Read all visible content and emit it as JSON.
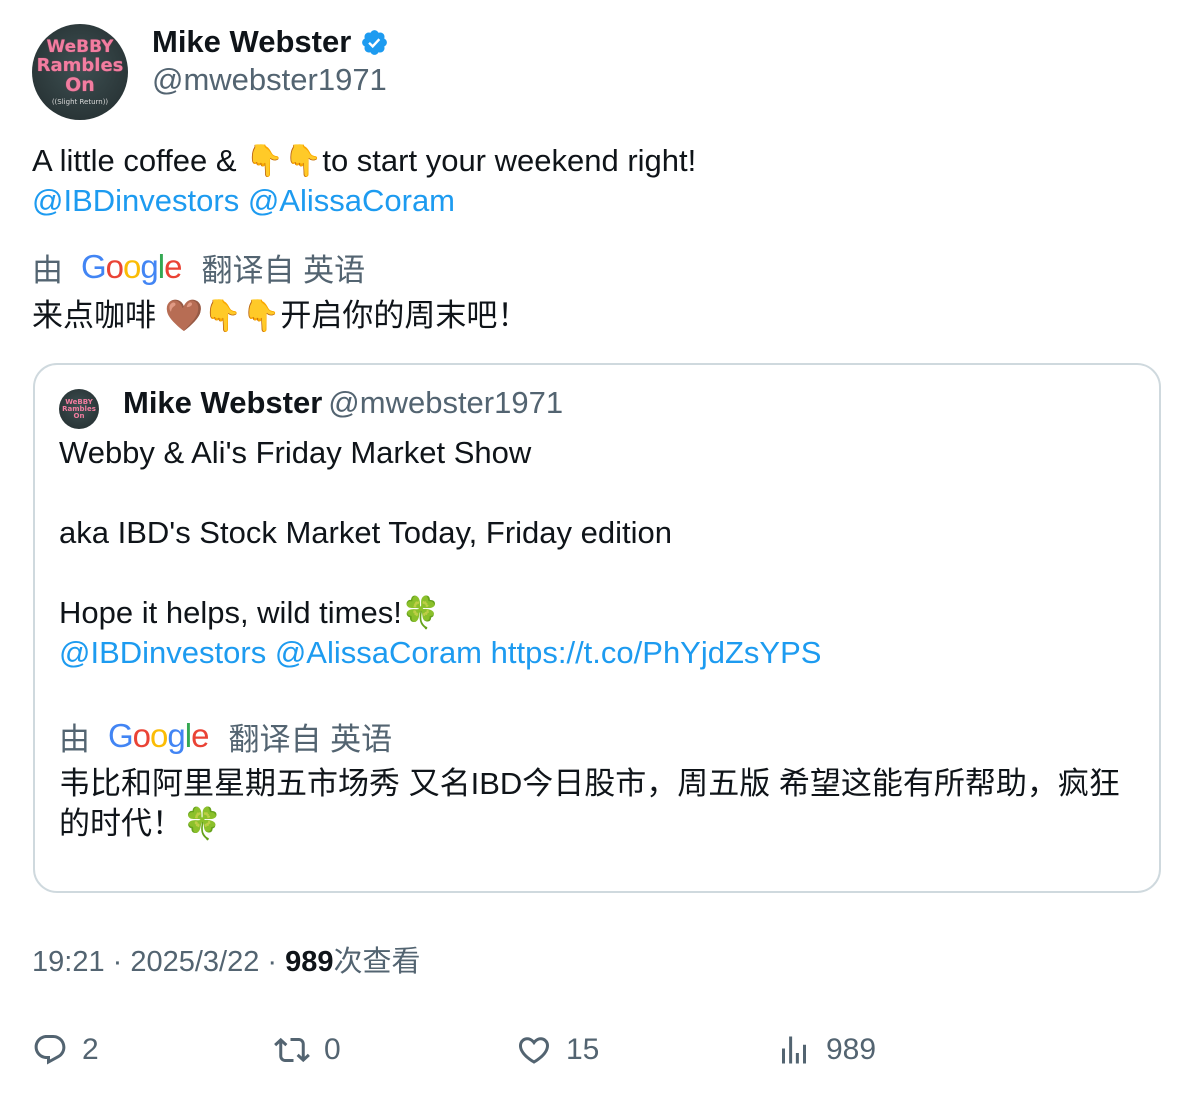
{
  "author": {
    "display_name": "Mike Webster",
    "handle": "@mwebster1971",
    "avatar_lines": [
      "WeBBY",
      "Rambles",
      "On",
      "((Slight Return))"
    ],
    "verified_icon": "verified-badge-icon"
  },
  "tweet": {
    "line1_before": "A little coffee & ",
    "line1_emoji": "👇👇",
    "line1_after": "to start your weekend right!",
    "mention1": "@IBDinvestors",
    "mention2": "@AlissaCoram"
  },
  "translation": {
    "prefix": "由",
    "provider_letters": [
      "G",
      "o",
      "o",
      "g",
      "l",
      "e"
    ],
    "suffix": "翻译自 英语",
    "text": "来点咖啡 🤎👇👇开启你的周末吧！"
  },
  "quote": {
    "display_name": "Mike Webster",
    "handle": "@mwebster1971",
    "avatar_lines": [
      "WeBBY",
      "Rambles",
      "On"
    ],
    "line1": "Webby & Ali's Friday Market Show",
    "line2": "aka IBD's Stock Market Today, Friday edition",
    "line3": "Hope it helps, wild times!🍀",
    "mention1": "@IBDinvestors",
    "mention2": "@AlissaCoram",
    "url": "https://t.co/PhYjdZsYPS",
    "translation_prefix": "由",
    "translation_suffix": "翻译自 英语",
    "translation_text": "韦比和阿里星期五市场秀 又名IBD今日股市，周五版 希望这能有所帮助，疯狂的时代！🍀"
  },
  "meta": {
    "time": "19:21",
    "separator": " · ",
    "date": "2025/3/22",
    "views_count": "989",
    "views_label": "次查看"
  },
  "actions": {
    "replies": "2",
    "retweets": "0",
    "likes": "15",
    "views": "989"
  },
  "colors": {
    "link": "#1d9bf0",
    "secondary_text": "#536471",
    "border": "#cfd9de",
    "verified": "#1d9bf0"
  }
}
